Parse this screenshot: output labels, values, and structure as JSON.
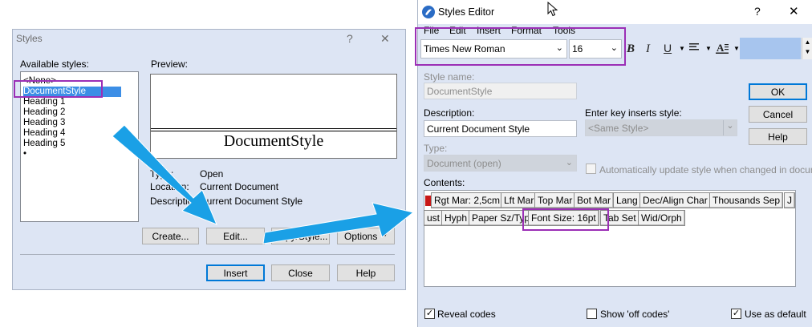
{
  "styles_dialog": {
    "title": "Styles",
    "help_glyph": "?",
    "close_glyph": "✕",
    "available_label": "Available styles:",
    "preview_label": "Preview:",
    "styles": [
      "<None>",
      "DocumentStyle",
      "Heading 1",
      "Heading 2",
      "Heading 3",
      "Heading 4",
      "Heading 5",
      "•"
    ],
    "selected_style": "DocumentStyle",
    "preview_text": "DocumentStyle",
    "info": {
      "type_label": "Type:",
      "type_value": "Open",
      "location_label": "Location:",
      "location_value": "Current Document",
      "description_label": "Description:",
      "description_value": "Current Document Style"
    },
    "buttons": {
      "create": "Create...",
      "edit": "Edit...",
      "copy": "Copy/Style...",
      "options": "Options",
      "insert": "Insert",
      "close": "Close",
      "help": "Help"
    }
  },
  "styles_editor": {
    "title": "Styles Editor",
    "help_glyph": "?",
    "close_glyph": "✕",
    "menu": [
      "File",
      "Edit",
      "Insert",
      "Format",
      "Tools"
    ],
    "font_name": "Times New Roman",
    "font_size": "16",
    "toolbar_glyphs": {
      "bold": "B",
      "italic": "I",
      "underline": "U"
    },
    "style_name_label": "Style name:",
    "style_name_value": "DocumentStyle",
    "description_label": "Description:",
    "description_value": "Current Document Style",
    "enter_key_label": "Enter key inserts style:",
    "enter_key_value": "<Same Style>",
    "type_label": "Type:",
    "type_value": "Document (open)",
    "auto_update_label": "Automatically update style when changed in document",
    "contents_label": "Contents:",
    "codes_row1": [
      "Rgt Mar: 2,5cm",
      "Lft Mar",
      "Top Mar",
      "Bot Mar",
      "Lang",
      "Dec/Align Char",
      "Thousands Sep",
      "J"
    ],
    "codes_row2": [
      "ust",
      "Hyph",
      "Paper Sz/Typ",
      "Font Size: 16pt",
      "Tab Set",
      "Wid/Orph"
    ],
    "buttons": {
      "ok": "OK",
      "cancel": "Cancel",
      "help": "Help"
    },
    "checkboxes": {
      "reveal_codes": "Reveal codes",
      "show_off_codes": "Show 'off codes'",
      "use_as_default": "Use as default"
    }
  },
  "colors": {
    "arrow": "#1aa0e6",
    "highlight": "#9b2fb6",
    "selection": "#3c8ee6",
    "dialog_bg": "#dde5f4"
  }
}
